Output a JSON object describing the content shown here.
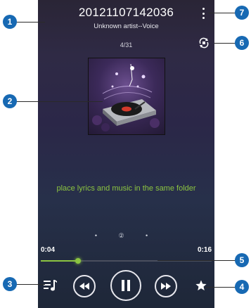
{
  "player": {
    "title": "20121107142036",
    "artist_line": "Unknown artist--Voice",
    "track_position": "4/31",
    "lyrics_message": "place lyrics and music in the same folder",
    "pager": "• ② •",
    "current_time": "0:04",
    "total_time": "0:16",
    "progress": 0.22
  },
  "callouts": {
    "c1": "1",
    "c2": "2",
    "c3": "3",
    "c4": "4",
    "c5": "5",
    "c6": "6",
    "c7": "7"
  },
  "icons": [
    "more-options-icon",
    "repeat-icon",
    "playlist-icon",
    "previous-icon",
    "pause-icon",
    "next-icon",
    "star-icon",
    "turntable-icon"
  ],
  "colors": {
    "accent": "#8cc441",
    "badge": "#1769b3"
  }
}
